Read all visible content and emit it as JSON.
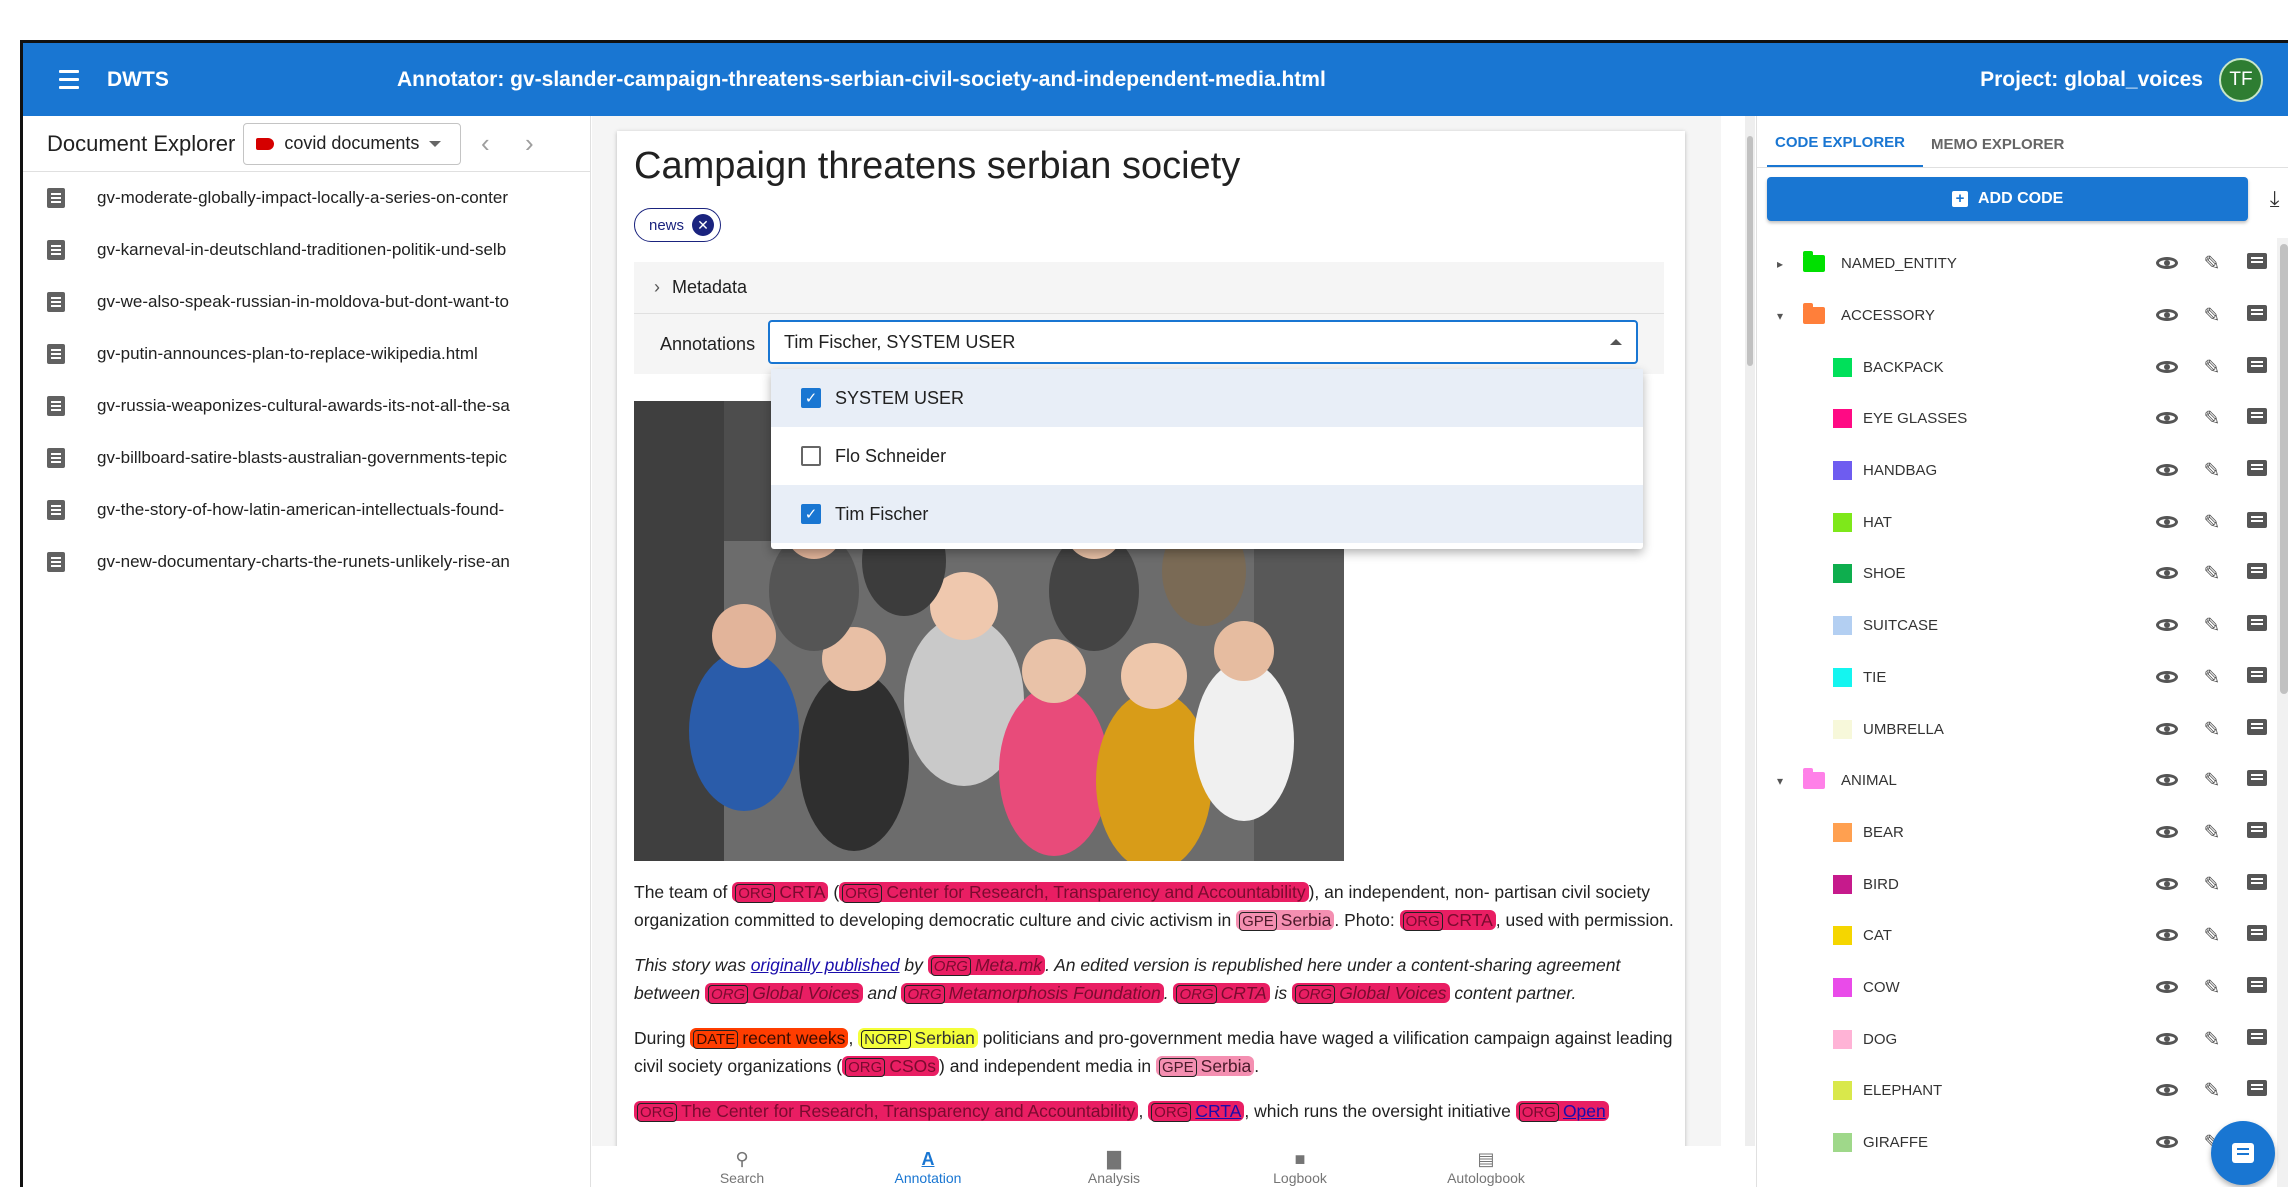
{
  "header": {
    "brand": "DWTS",
    "title": "Annotator: gv-slander-campaign-threatens-serbian-civil-society-and-independent-media.html",
    "project": "Project: global_voices",
    "avatar_initials": "TF"
  },
  "explorer": {
    "title": "Document Explorer",
    "tag_filter": "covid documents",
    "tag_color": "#d50000",
    "documents": [
      "gv-moderate-globally-impact-locally-a-series-on-conter",
      "gv-karneval-in-deutschland-traditionen-politik-und-selb",
      "gv-we-also-speak-russian-in-moldova-but-dont-want-to",
      "gv-putin-announces-plan-to-replace-wikipedia.html",
      "gv-russia-weaponizes-cultural-awards-its-not-all-the-sa",
      "gv-billboard-satire-blasts-australian-governments-tepic",
      "gv-the-story-of-how-latin-american-intellectuals-found-",
      "gv-new-documentary-charts-the-runets-unlikely-rise-an"
    ]
  },
  "document": {
    "title": "Campaign threatens serbian society",
    "tag": "news",
    "metadata_label": "Metadata",
    "annotations_label": "Annotations",
    "annotations_value": "Tim Fischer, SYSTEM USER",
    "annotator_options": [
      {
        "label": "SYSTEM USER",
        "checked": true
      },
      {
        "label": "Flo Schneider",
        "checked": false
      },
      {
        "label": "Tim Fischer",
        "checked": true
      }
    ],
    "p1": {
      "t1": "The team of ",
      "e1_lbl": "ORG",
      "e1": "CRTA",
      "t2": " (",
      "e2_lbl": "ORG",
      "e2": "Center for Research, Transparency and Accountability",
      "t3": "), an independent, non- partisan civil society organization committed to developing democratic culture and civic activism in ",
      "e3_lbl": "GPE",
      "e3": "Serbia",
      "t4": ". Photo: ",
      "e4_lbl": "ORG",
      "e4": "CRTA",
      "t5": ", used with permission."
    },
    "p2": {
      "t1": "This story was ",
      "link": "originally published",
      "t2": " by ",
      "e1_lbl": "ORG",
      "e1": "Meta.mk",
      "t3": ". An edited version is republished here under a content-sharing agreement between ",
      "e2_lbl": "ORG",
      "e2": "Global Voices",
      "t4": " and ",
      "e3_lbl": "ORG",
      "e3": "Metamorphosis Foundation",
      "t5": ". ",
      "e4_lbl": "ORG",
      "e4": "CRTA",
      "t6": " is ",
      "e5_lbl": "ORG",
      "e5": "Global Voices",
      "t7": " content partner."
    },
    "p3": {
      "t1": "During ",
      "e1_lbl": "DATE",
      "e1": "recent weeks",
      "t2": ", ",
      "e2_lbl": "NORP",
      "e2": "Serbian",
      "t3": " politicians and pro-government media have waged a vilification campaign against leading civil society organizations (",
      "e3_lbl": "ORG",
      "e3": "CSOs",
      "t4": ") and independent media in ",
      "e4_lbl": "GPE",
      "e4": "Serbia",
      "t5": "."
    },
    "p4": {
      "e1_lbl": "ORG",
      "e1": "The Center for Research, Transparency and Accountability",
      "t1": ", ",
      "e2_lbl": "ORG",
      "e2": "CRTA",
      "t2": ", which runs the oversight initiative ",
      "e3_lbl": "ORG",
      "e3": "Open"
    }
  },
  "bottom_nav": [
    "Search",
    "Annotation",
    "Analysis",
    "Logbook",
    "Autologbook"
  ],
  "code_explorer": {
    "tab_codes": "CODE EXPLORER",
    "tab_memos": "MEMO EXPLORER",
    "add_code": "ADD CODE",
    "codes": [
      {
        "name": "NAMED_ENTITY",
        "color": "#00e000",
        "level": 0,
        "expander": "▸"
      },
      {
        "name": "ACCESSORY",
        "color": "#ff7f3a",
        "level": 0,
        "expander": "▾"
      },
      {
        "name": "BACKPACK",
        "color": "#00e05a",
        "level": 1
      },
      {
        "name": "EYE GLASSES",
        "color": "#ff0a84",
        "level": 1
      },
      {
        "name": "HANDBAG",
        "color": "#6e5cf0",
        "level": 1
      },
      {
        "name": "HAT",
        "color": "#7ee81a",
        "level": 1
      },
      {
        "name": "SHOE",
        "color": "#0eae4e",
        "level": 1
      },
      {
        "name": "SUITCASE",
        "color": "#b3cff2",
        "level": 1
      },
      {
        "name": "TIE",
        "color": "#14f5f0",
        "level": 1
      },
      {
        "name": "UMBRELLA",
        "color": "#f7f8da",
        "level": 1
      },
      {
        "name": "ANIMAL",
        "color": "#ff80e8",
        "level": 0,
        "expander": "▾"
      },
      {
        "name": "BEAR",
        "color": "#ffa050",
        "level": 1
      },
      {
        "name": "BIRD",
        "color": "#c61a8c",
        "level": 1
      },
      {
        "name": "CAT",
        "color": "#f5d600",
        "level": 1
      },
      {
        "name": "COW",
        "color": "#e94be9",
        "level": 1
      },
      {
        "name": "DOG",
        "color": "#ffb3d6",
        "level": 1
      },
      {
        "name": "ELEPHANT",
        "color": "#d9e84b",
        "level": 1
      },
      {
        "name": "GIRAFFE",
        "color": "#9fd88a",
        "level": 1
      }
    ]
  }
}
